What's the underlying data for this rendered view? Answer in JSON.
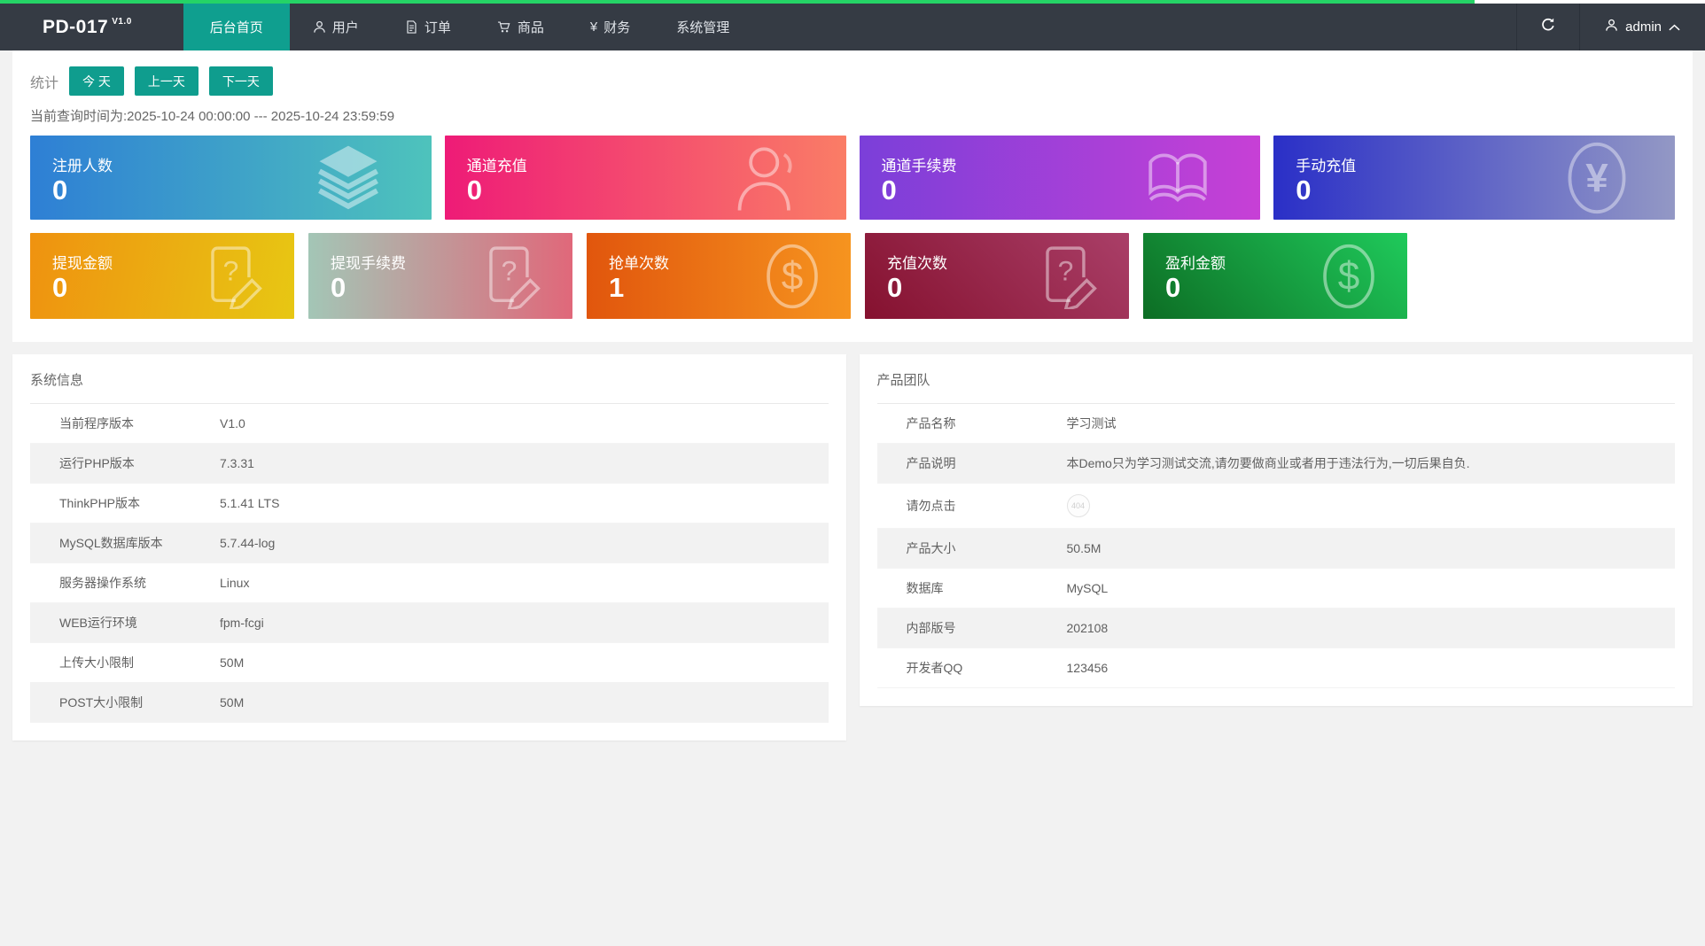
{
  "page": {
    "progress_percent": 86.5,
    "progress_color": "#25d366",
    "navbar_color": "#353b44",
    "accent_teal": "#0f9d8e"
  },
  "navbar": {
    "brand": "PD-017",
    "brand_version": "V1.0",
    "items": [
      {
        "label": "后台首页",
        "icon": "none",
        "active": true
      },
      {
        "label": "用户",
        "icon": "user-icon",
        "active": false
      },
      {
        "label": "订单",
        "icon": "document-icon",
        "active": false
      },
      {
        "label": "商品",
        "icon": "cart-icon",
        "active": false
      },
      {
        "label": "财务",
        "icon": "yen-icon",
        "active": false,
        "icon_glyph": "¥"
      },
      {
        "label": "系统管理",
        "icon": "none",
        "active": false
      }
    ],
    "refresh_icon": "refresh-icon",
    "username": "admin"
  },
  "stats": {
    "label": "统计",
    "buttons": [
      {
        "label": "今 天"
      },
      {
        "label": "上一天"
      },
      {
        "label": "下一天"
      }
    ],
    "query_time": "当前查询时间为:2025-10-24 00:00:00 --- 2025-10-24 23:59:59",
    "cards_row1": [
      {
        "label": "注册人数",
        "value": "0",
        "icon": "layers-icon",
        "c1": "#2e7fd5",
        "c2": "#4ec3bc",
        "angle": 90
      },
      {
        "label": "通道充值",
        "value": "0",
        "icon": "user-icon",
        "c1": "#ee1b77",
        "c2": "#fa7d66",
        "angle": 90
      },
      {
        "label": "通道手续费",
        "value": "0",
        "icon": "book-icon",
        "c1": "#7b3fd9",
        "c2": "#c740d6",
        "angle": 90
      },
      {
        "label": "手动充值",
        "value": "0",
        "icon": "yen-circle-icon",
        "c1": "#2a2fc7",
        "c2": "#9398c5",
        "angle": 90
      }
    ],
    "cards_row2": [
      {
        "label": "提现金额",
        "value": "0",
        "icon": "edit-doc-icon",
        "c1": "#ef9210",
        "c2": "#e7c713",
        "angle": 100
      },
      {
        "label": "提现手续费",
        "value": "0",
        "icon": "edit-doc-icon",
        "c1": "#a3c6b6",
        "c2": "#e0687a",
        "angle": 90
      },
      {
        "label": "抢单次数",
        "value": "1",
        "icon": "dollar-circle-icon",
        "c1": "#e1560d",
        "c2": "#f6941f",
        "angle": 90
      },
      {
        "label": "充值次数",
        "value": "0",
        "icon": "edit-doc-icon",
        "c1": "#85112f",
        "c2": "#aa3f68",
        "angle": 45
      },
      {
        "label": "盈利金额",
        "value": "0",
        "icon": "dollar-circle-icon",
        "c1": "#0d6d24",
        "c2": "#1fca5b",
        "angle": 45
      }
    ]
  },
  "system_info": {
    "title": "系统信息",
    "rows": [
      {
        "label": "当前程序版本",
        "value": "V1.0"
      },
      {
        "label": "运行PHP版本",
        "value": "7.3.31"
      },
      {
        "label": "ThinkPHP版本",
        "value": "5.1.41 LTS"
      },
      {
        "label": "MySQL数据库版本",
        "value": "5.7.44-log"
      },
      {
        "label": "服务器操作系统",
        "value": "Linux"
      },
      {
        "label": "WEB运行环境",
        "value": "fpm-fcgi"
      },
      {
        "label": "上传大小限制",
        "value": "50M"
      },
      {
        "label": "POST大小限制",
        "value": "50M"
      }
    ]
  },
  "product_team": {
    "title": "产品团队",
    "badge_text": "404",
    "rows": [
      {
        "label": "产品名称",
        "value": "学习测试"
      },
      {
        "label": "产品说明",
        "value": "本Demo只为学习测试交流,请勿要做商业或者用于违法行为,一切后果自负."
      },
      {
        "label": "请勿点击",
        "value": ""
      },
      {
        "label": "产品大小",
        "value": "50.5M"
      },
      {
        "label": "数据库",
        "value": "MySQL"
      },
      {
        "label": "内部版号",
        "value": "202108"
      },
      {
        "label": "开发者QQ",
        "value": "123456"
      }
    ]
  }
}
